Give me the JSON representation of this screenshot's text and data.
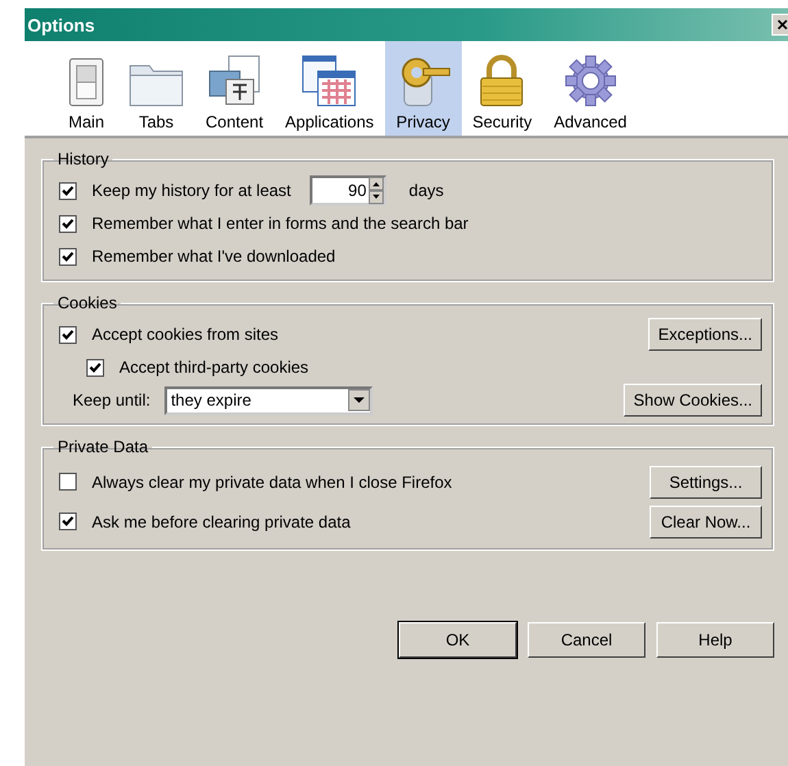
{
  "window": {
    "title": "Options"
  },
  "panes": [
    {
      "label": "Main",
      "selected": false,
      "kind": "switch"
    },
    {
      "label": "Tabs",
      "selected": false,
      "kind": "folder"
    },
    {
      "label": "Content",
      "selected": false,
      "kind": "content"
    },
    {
      "label": "Applications",
      "selected": false,
      "kind": "apps"
    },
    {
      "label": "Privacy",
      "selected": true,
      "kind": "key"
    },
    {
      "label": "Security",
      "selected": false,
      "kind": "lock"
    },
    {
      "label": "Advanced",
      "selected": false,
      "kind": "gear"
    }
  ],
  "history": {
    "title": "History",
    "keep_history": {
      "label": "Keep my history for at least",
      "checked": true,
      "value": "90",
      "unit": "days"
    },
    "options": [
      {
        "label": "Remember what I enter in forms and the search bar",
        "checked": true
      },
      {
        "label": "Remember what I've downloaded",
        "checked": true
      }
    ]
  },
  "cookies": {
    "title": "Cookies",
    "accept": {
      "label": "Accept cookies from sites",
      "checked": true
    },
    "exceptions_button": {
      "label": "Exceptions..."
    },
    "third_party": {
      "label": "Accept third-party cookies",
      "checked": true
    },
    "keep_until": {
      "label": "Keep until:",
      "value": "they expire"
    },
    "show_cookies_button": {
      "label": "Show Cookies..."
    }
  },
  "private_data": {
    "title": "Private Data",
    "rows": [
      {
        "label": "Always clear my private data when I close Firefox",
        "checked": false,
        "button": {
          "label": "Settings..."
        }
      },
      {
        "label": "Ask me before clearing private data",
        "checked": true,
        "button": {
          "label": "Clear Now..."
        }
      }
    ]
  },
  "buttons": [
    {
      "label": "OK",
      "default": true
    },
    {
      "label": "Cancel",
      "default": false
    },
    {
      "label": "Help",
      "default": false
    }
  ]
}
